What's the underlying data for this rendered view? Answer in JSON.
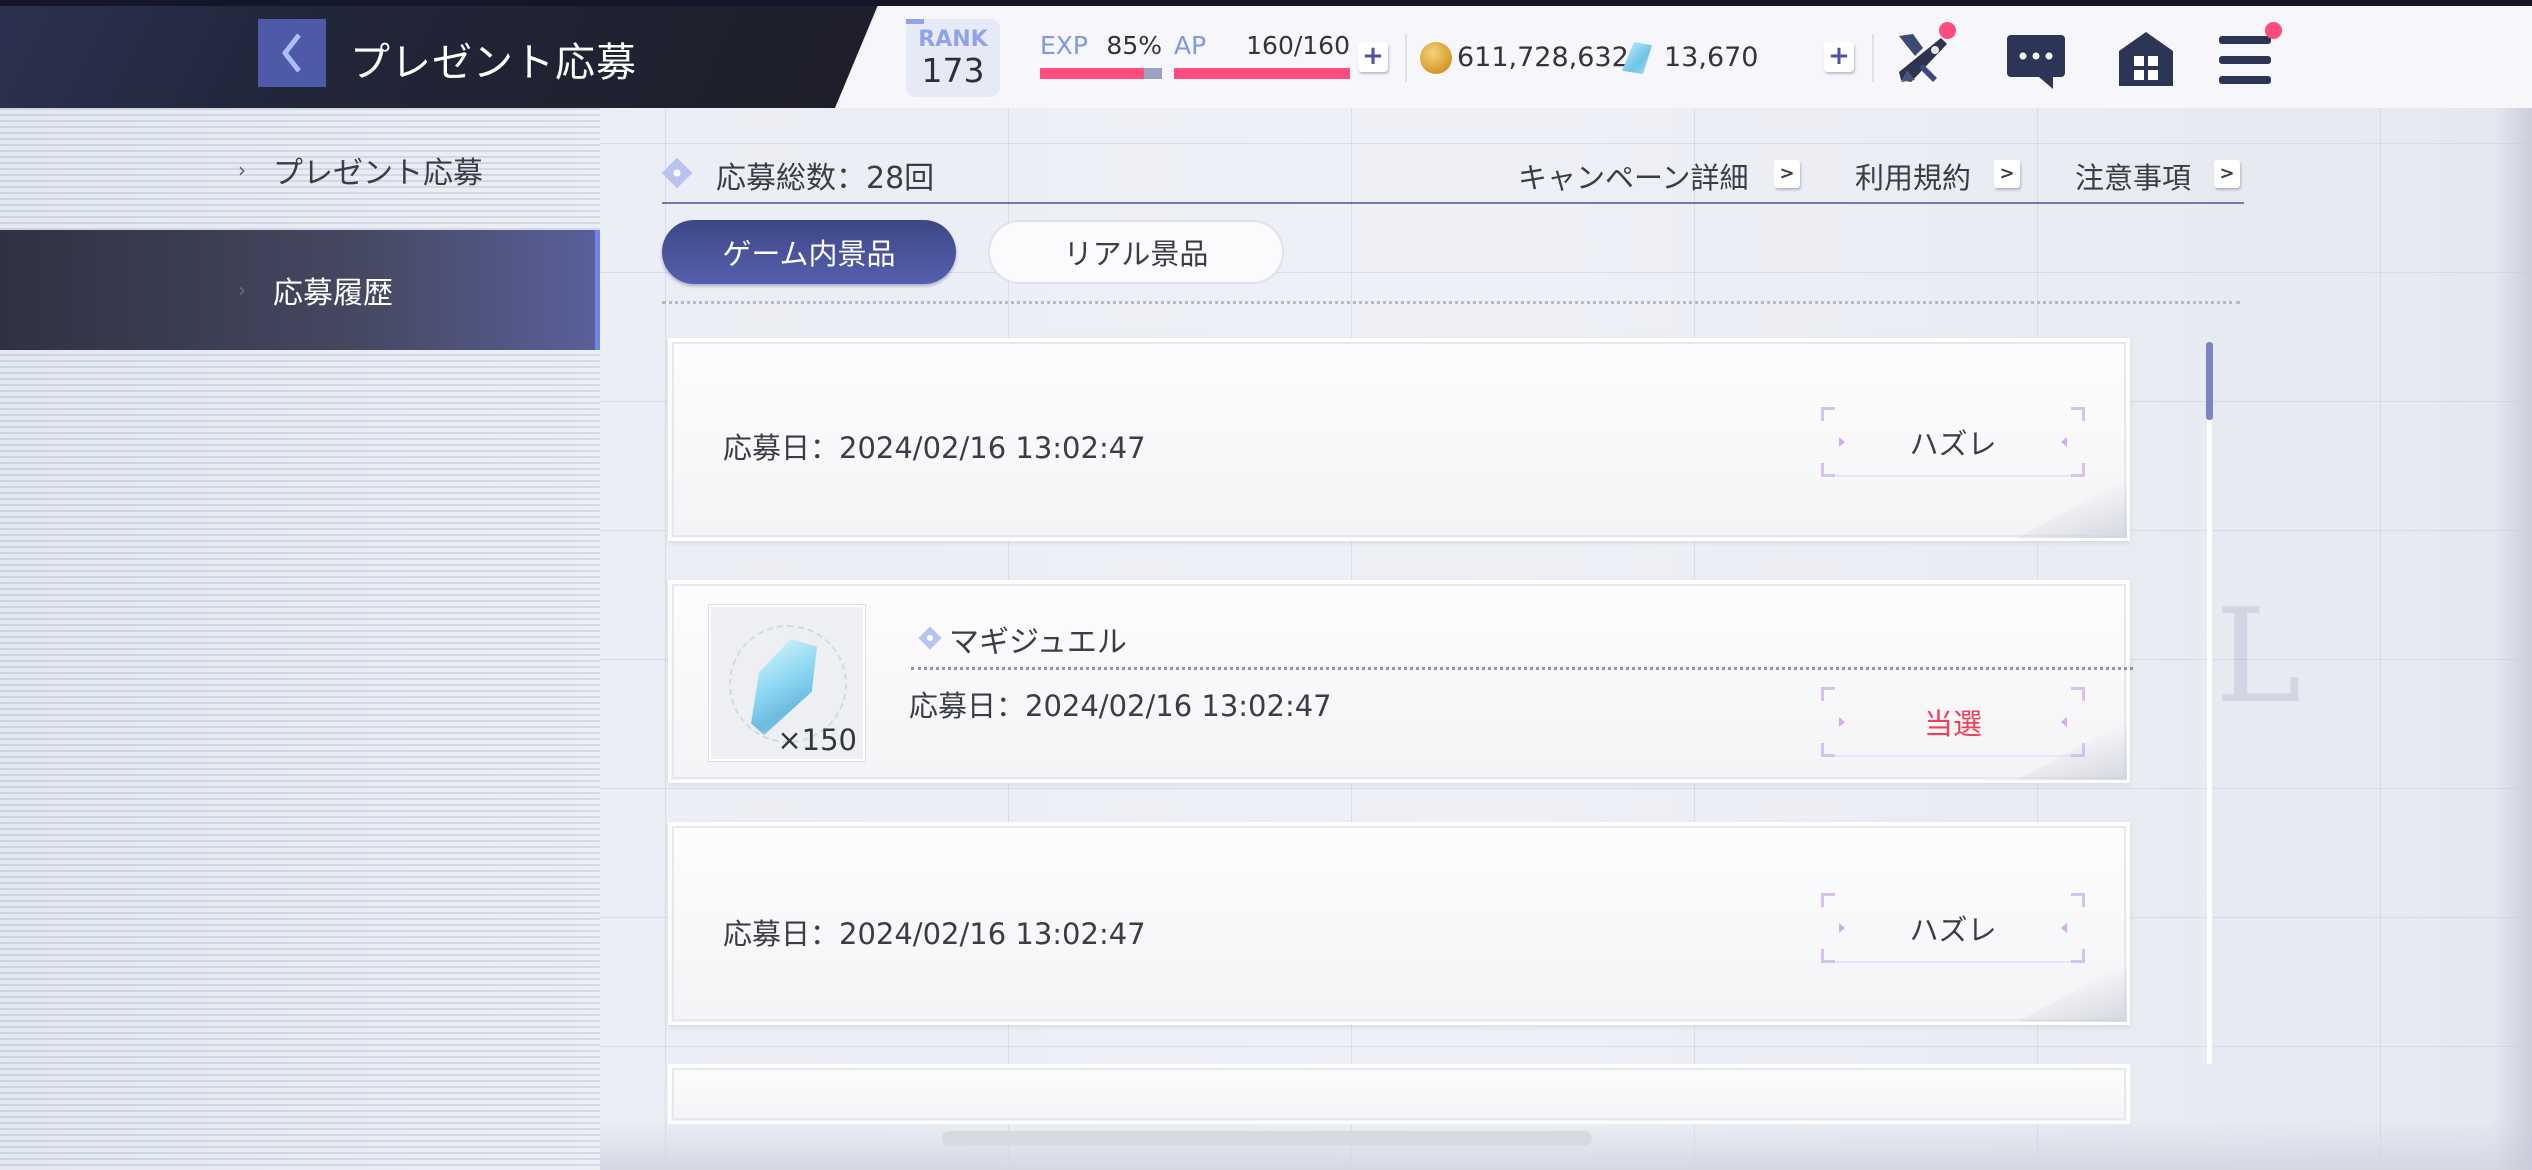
{
  "header": {
    "title": "プレゼント応募",
    "back_icon": "chevron-left-icon",
    "rank": {
      "label": "RANK",
      "value": "173"
    },
    "exp": {
      "label": "EXP",
      "value": "85%",
      "progress": 0.85
    },
    "ap": {
      "label": "AP",
      "value": "160/160",
      "progress": 1.0
    },
    "add_ap_label": "+",
    "coins": {
      "icon": "coin-icon",
      "value": "611,728,632"
    },
    "gems": {
      "icon": "gem-icon",
      "value": "13,670"
    },
    "add_gems_label": "+",
    "nav_icons": [
      {
        "name": "battle-icon",
        "badge": true
      },
      {
        "name": "chat-icon",
        "badge": false
      },
      {
        "name": "home-icon",
        "badge": false
      },
      {
        "name": "menu-icon",
        "badge": true
      }
    ],
    "colors": {
      "accent": "#ff4b7e",
      "primary": "#4e5aa8"
    }
  },
  "sidebar": {
    "items": [
      {
        "label": "プレゼント応募",
        "active": false
      },
      {
        "label": "応募履歴",
        "active": true
      }
    ]
  },
  "main": {
    "total_label": "応募総数：28回",
    "links": [
      {
        "label": "キャンペーン詳細"
      },
      {
        "label": "利用規約"
      },
      {
        "label": "注意事項"
      }
    ],
    "tabs": [
      {
        "label": "ゲーム内景品",
        "active": true
      },
      {
        "label": "リアル景品",
        "active": false
      }
    ],
    "history": [
      {
        "date": "応募日：2024/02/16 13:02:47",
        "result": "ハズレ",
        "win": false
      },
      {
        "item_name": "マギジュエル",
        "item_qty": "×150",
        "date": "応募日：2024/02/16 13:02:47",
        "result": "当選",
        "win": true
      },
      {
        "date": "応募日：2024/02/16 13:02:47",
        "result": "ハズレ",
        "win": false
      }
    ],
    "win_color": "#ef3f5a"
  }
}
